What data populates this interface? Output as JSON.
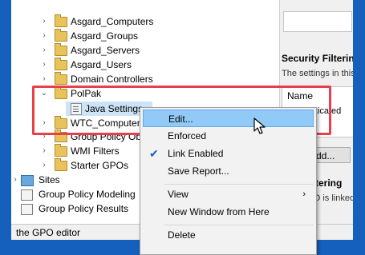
{
  "tree": {
    "items": [
      {
        "label": "Asgard_Computers",
        "type": "folder"
      },
      {
        "label": "Asgard_Groups",
        "type": "folder"
      },
      {
        "label": "Asgard_Servers",
        "type": "folder"
      },
      {
        "label": "Asgard_Users",
        "type": "folder"
      },
      {
        "label": "Domain Controllers",
        "type": "folder"
      },
      {
        "label": "PolPak",
        "type": "folder"
      },
      {
        "label": "Java Settings",
        "type": "gpo-link"
      },
      {
        "label": "WTC_Computers",
        "type": "folder"
      },
      {
        "label": "Group Policy Ob",
        "type": "folder"
      },
      {
        "label": "WMI Filters",
        "type": "folder"
      },
      {
        "label": "Starter GPOs",
        "type": "folder"
      },
      {
        "label": "Sites",
        "type": "sites"
      },
      {
        "label": "Group Policy Modeling",
        "type": "modeling"
      },
      {
        "label": "Group Policy Results",
        "type": "results"
      }
    ]
  },
  "right_pane": {
    "security_filtering_title": "Security Filtering",
    "security_filtering_text": "The settings in this",
    "name_header": "Name",
    "auth_users": "Authenticated",
    "add_button": "Add...",
    "wmi_title": "WMI Filtering",
    "wmi_text": "This GPO is linked"
  },
  "status_bar": {
    "text": "the GPO editor"
  },
  "context_menu": {
    "edit": "Edit...",
    "enforced": "Enforced",
    "link_enabled": "Link Enabled",
    "link_enabled_checked": true,
    "save_report": "Save Report...",
    "view": "View",
    "new_window": "New Window from Here",
    "delete": "Delete"
  },
  "colors": {
    "background": "#1560bd",
    "highlight_box": "#e8404a",
    "menu_hover": "#91c9f7"
  }
}
